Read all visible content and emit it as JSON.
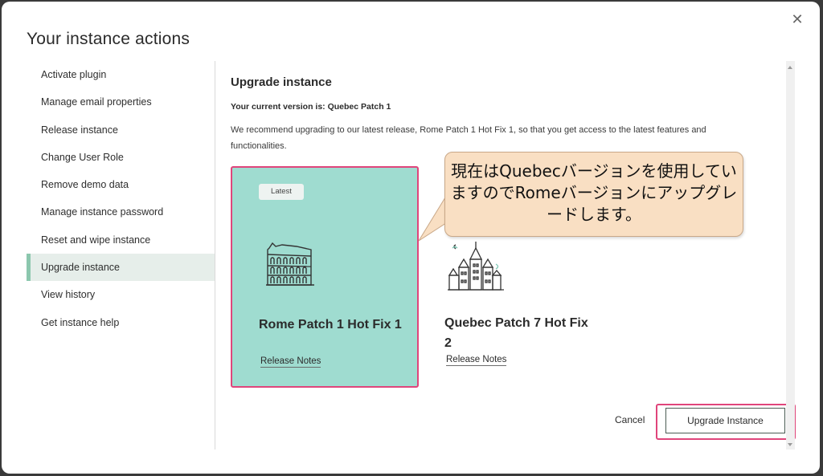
{
  "modal": {
    "title": "Your instance actions",
    "close_icon": "close-icon"
  },
  "sidebar": {
    "items": [
      {
        "label": "Activate plugin"
      },
      {
        "label": "Manage email properties"
      },
      {
        "label": "Release instance"
      },
      {
        "label": "Change User Role"
      },
      {
        "label": "Remove demo data"
      },
      {
        "label": "Manage instance password"
      },
      {
        "label": "Reset and wipe instance"
      },
      {
        "label": "Upgrade instance",
        "active": true
      },
      {
        "label": "View history"
      },
      {
        "label": "Get instance help"
      }
    ]
  },
  "main": {
    "title": "Upgrade instance",
    "current_version": "Your current version is: Quebec Patch 1",
    "recommendation": "We recommend upgrading to our latest release, Rome Patch 1 Hot Fix 1, so that you get access to the latest features and functionalities.",
    "cards": [
      {
        "badge": "Latest",
        "title": "Rome Patch 1 Hot Fix 1",
        "link": "Release Notes",
        "icon": "colosseum-icon",
        "selected": true
      },
      {
        "title": "Quebec Patch 7 Hot Fix 2",
        "link": "Release Notes",
        "icon": "chateau-frontenac-icon",
        "selected": false
      }
    ],
    "annotation": "現在はQuebecバージョンを使用していますのでRomeバージョンにアップグレードします。",
    "cancel_label": "Cancel",
    "upgrade_label": "Upgrade Instance"
  },
  "colors": {
    "selected_card_bg": "#9fdcd0",
    "highlight_border": "#e0457b",
    "active_nav_bar": "#8cc7ae",
    "callout_bg": "#f9dfc3"
  }
}
